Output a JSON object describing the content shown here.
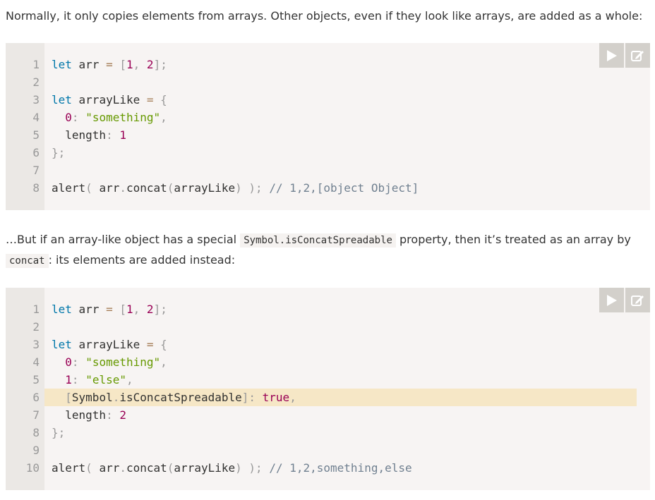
{
  "paragraphs": {
    "p1": "Normally, it only copies elements from arrays. Other objects, even if they look like arrays, are added as a whole:",
    "p2_before": "…But if an array-like object has a special",
    "p2_code1": "Symbol.isConcatSpreadable",
    "p2_after": "property, then it’s treated as an array by",
    "p2_code2": "concat",
    "p2_end": ": its elements are added instead:"
  },
  "block1": {
    "lines": [
      {
        "n": "1",
        "src": "let arr = [1, 2];"
      },
      {
        "n": "2",
        "src": ""
      },
      {
        "n": "3",
        "src": "let arrayLike = {"
      },
      {
        "n": "4",
        "src": "  0: \"something\","
      },
      {
        "n": "5",
        "src": "  length: 1"
      },
      {
        "n": "6",
        "src": "};"
      },
      {
        "n": "7",
        "src": ""
      },
      {
        "n": "8",
        "src": "alert( arr.concat(arrayLike) ); // 1,2,[object Object]"
      }
    ]
  },
  "block2": {
    "lines": [
      {
        "n": "1",
        "src": "let arr = [1, 2];"
      },
      {
        "n": "2",
        "src": ""
      },
      {
        "n": "3",
        "src": "let arrayLike = {"
      },
      {
        "n": "4",
        "src": "  0: \"something\","
      },
      {
        "n": "5",
        "src": "  1: \"else\","
      },
      {
        "n": "6",
        "src": "  [Symbol.isConcatSpreadable]: true,"
      },
      {
        "n": "7",
        "src": "  length: 2"
      },
      {
        "n": "8",
        "src": "};"
      },
      {
        "n": "9",
        "src": ""
      },
      {
        "n": "10",
        "src": "alert( arr.concat(arrayLike) ); // 1,2,something,else"
      }
    ],
    "highlighted_line": 6
  },
  "icons": {
    "run": "play-icon",
    "edit": "edit-icon"
  },
  "colors": {
    "keyword": "#0077aa",
    "string": "#669900",
    "number": "#990055",
    "comment": "#708090",
    "highlight": "#f6e7c6",
    "block_bg": "#f7f4f3",
    "gutter_bg": "#ebe8e5",
    "button_bg": "#d3d0cb"
  }
}
